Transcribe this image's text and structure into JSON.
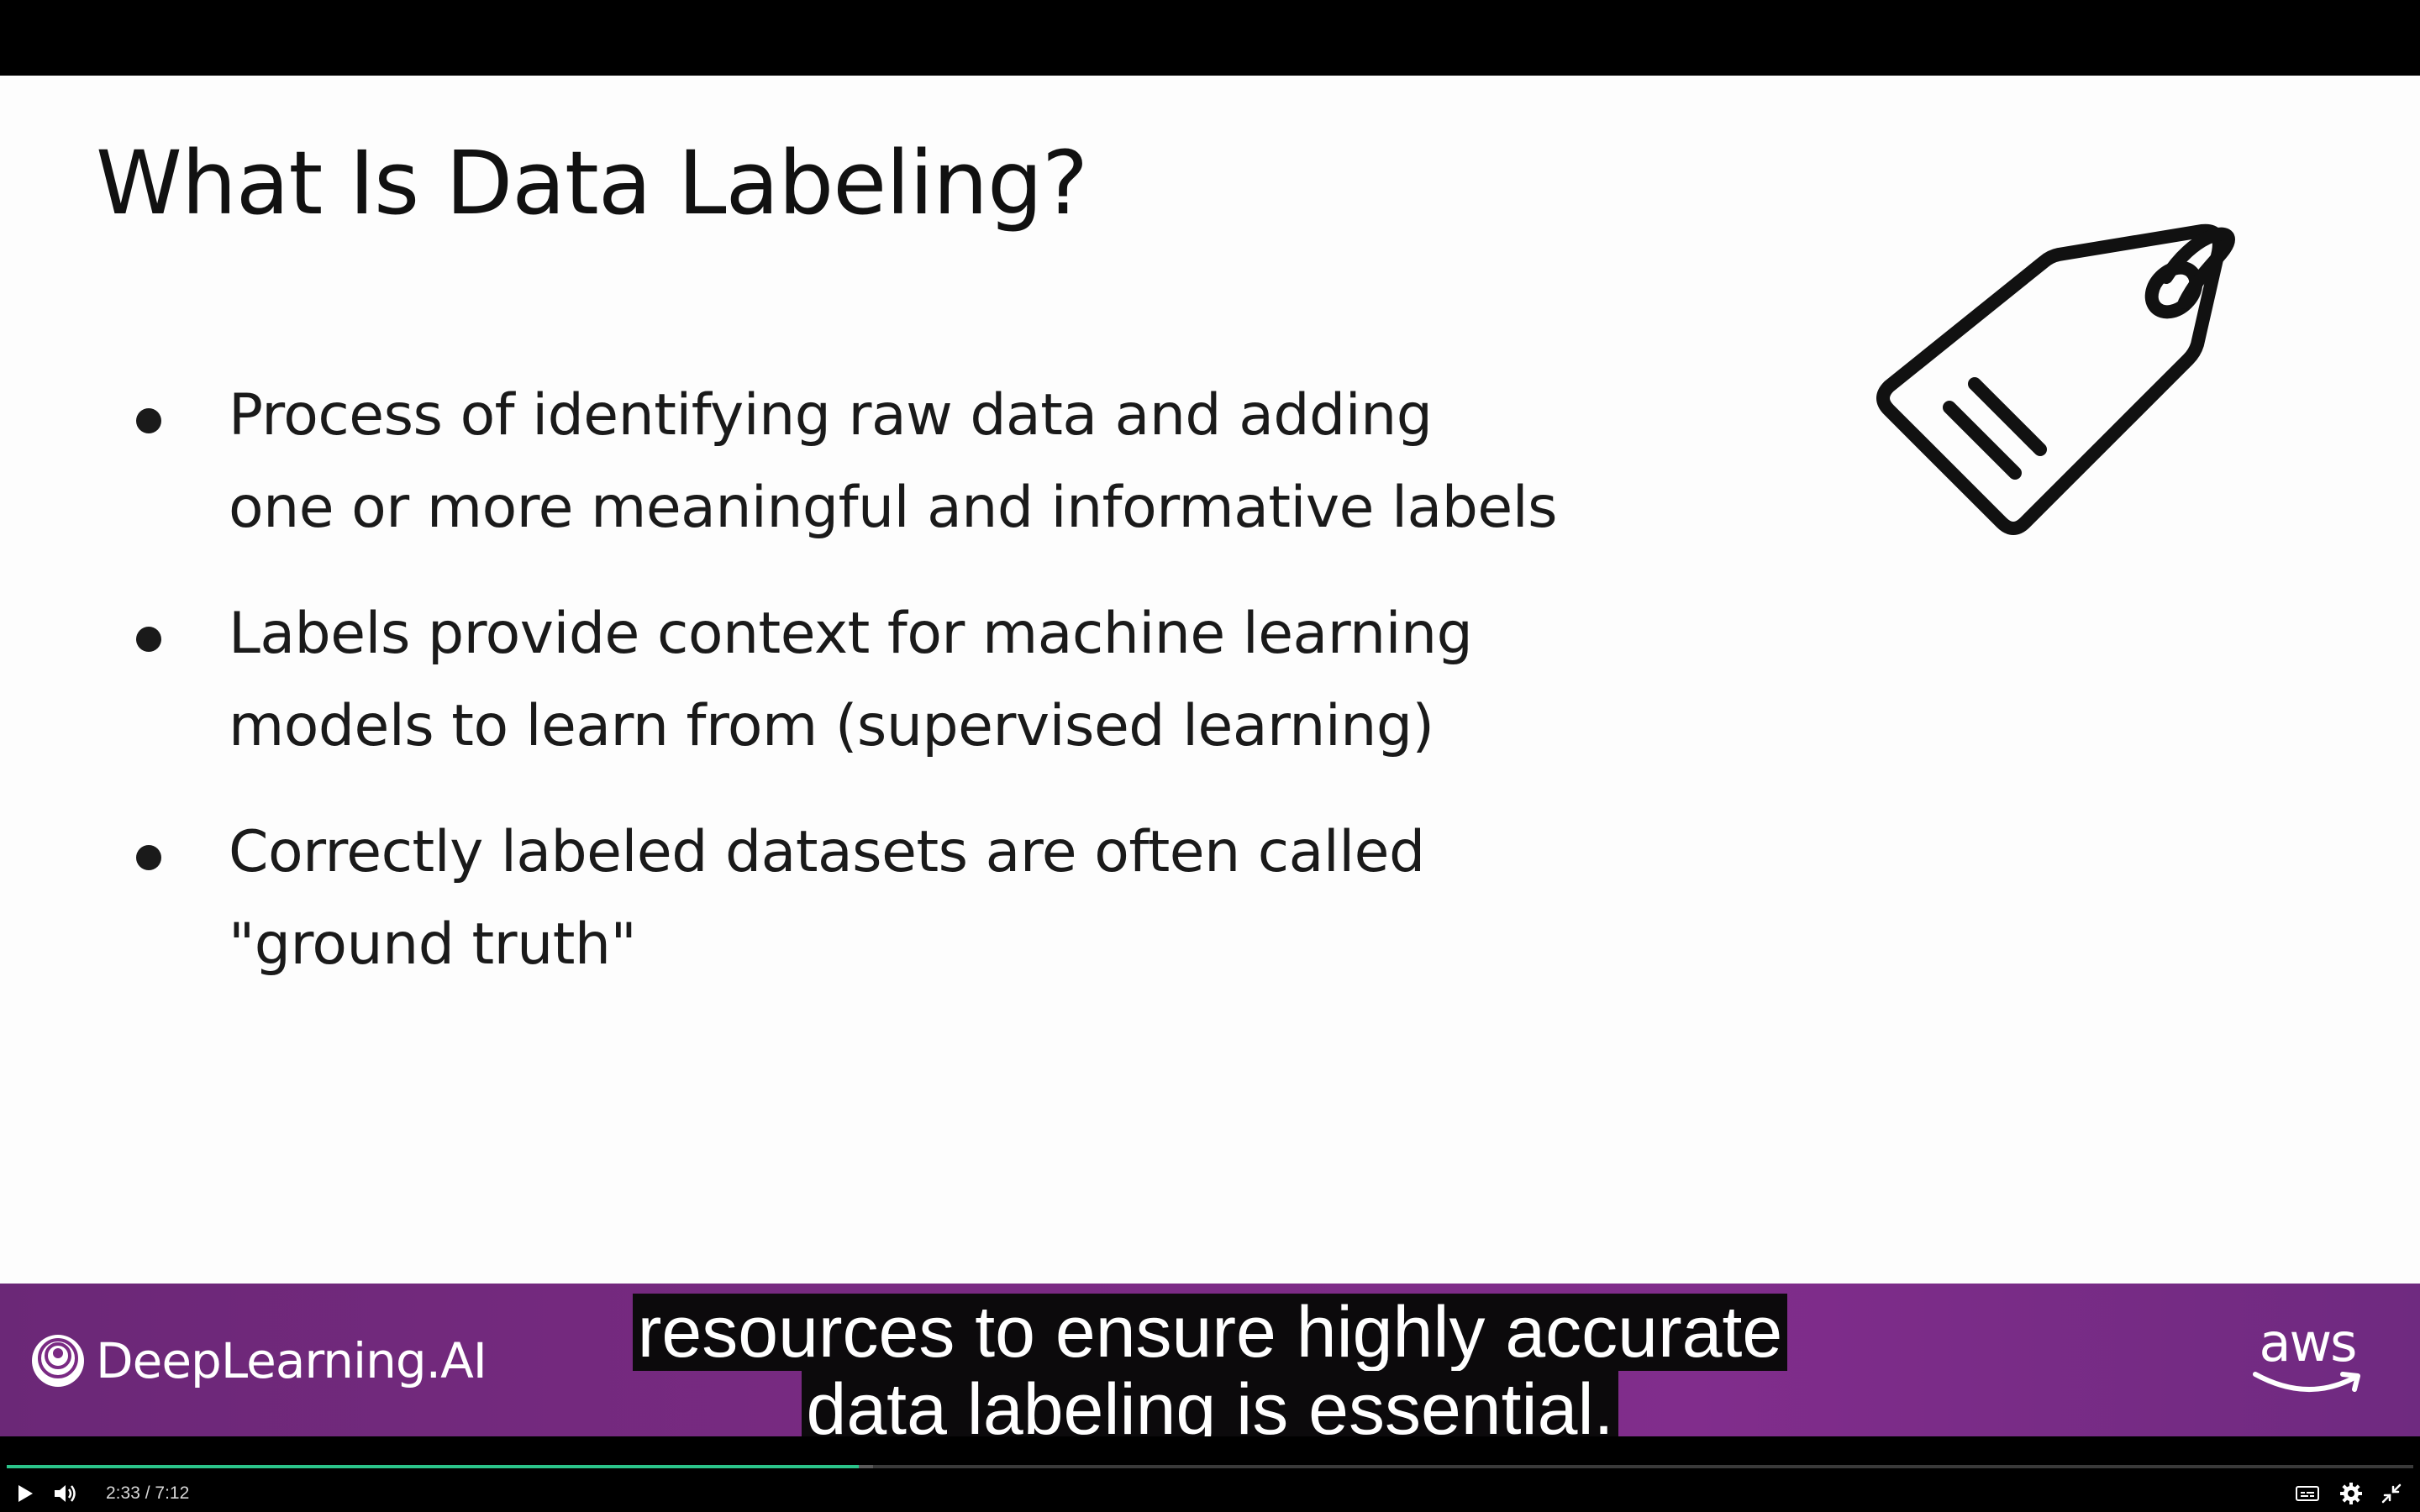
{
  "slide": {
    "title": "What Is Data Labeling?",
    "bullets": [
      {
        "lines": [
          "Process of identifying raw data and adding",
          "one or more meaningful and informative labels"
        ]
      },
      {
        "lines": [
          "Labels provide context for machine learning",
          "models to learn from (supervised learning)"
        ]
      },
      {
        "lines": [
          "Correctly labeled datasets are often called",
          "\"ground truth\""
        ]
      }
    ],
    "icon": "tag-icon"
  },
  "brand_bar": {
    "left_logo_text": "DeepLearning.AI",
    "right_logo_text": "aws"
  },
  "captions": {
    "line1": "resources to ensure highly accurate",
    "line2": "data labeling is essential."
  },
  "player": {
    "current_time": "2:33",
    "separator": "/",
    "duration": "7:12",
    "progress_fraction": 0.354,
    "buffered_fraction": 0.36,
    "accent_color": "#2bc48a",
    "brand_color": "#7a2a83",
    "buttons": {
      "play": "play-icon",
      "volume": "volume-icon",
      "captions": "captions-icon",
      "settings": "gear-icon",
      "exit_fullscreen": "exit-fullscreen-icon"
    }
  }
}
